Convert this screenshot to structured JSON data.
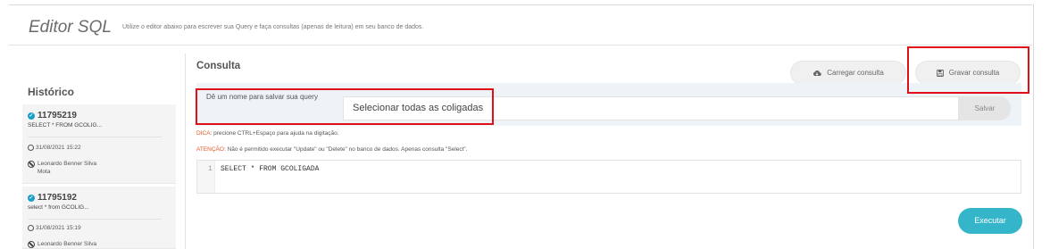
{
  "header": {
    "title": "Editor SQL",
    "description": "Utilize o editor abaixo para escrever sua Query e faça consultas (apenas de leitura) em seu banco de dados."
  },
  "sidebar": {
    "title": "Histórico",
    "items": [
      {
        "id": "11795219",
        "query": "SELECT * FROM GCOLIG...",
        "date": "31/08/2021 15:22",
        "user": "Leonardo Benner Silva",
        "user2": "Mota"
      },
      {
        "id": "11795192",
        "query": "select * from GCOLIG...",
        "date": "31/08/2021 15:19",
        "user": "Leonardo Benner Silva"
      }
    ]
  },
  "main": {
    "title": "Consulta",
    "load_label": "Carregar consulta",
    "save_query_label": "Gravar consulta",
    "name_label": "Dê um nome para salvar sua query",
    "name_value": "Selecionar todas as coligadas",
    "save_label": "Salvar",
    "tip1_key": "DICA",
    "tip1_text": ": precione CTRL+Espaço para ajuda na digitação.",
    "tip2_key": "ATENÇÃO",
    "tip2_text": ": Não é permitido executar \"Update\" ou \"Delete\" no banco de dados. Apenas consulta \"Select\".",
    "line_number": "1",
    "code": "SELECT * FROM GCOLIGADA",
    "execute_label": "Executar"
  },
  "colors": {
    "accent": "#35b5c9",
    "highlight": "#e0101a",
    "warning": "#e8572a"
  }
}
